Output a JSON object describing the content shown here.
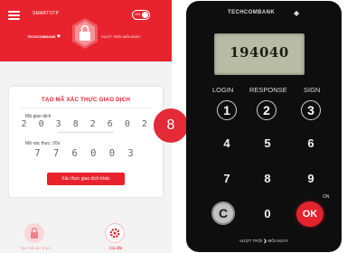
{
  "app": {
    "name": "SMARTOTP",
    "toggle_label": "ON",
    "brand_left": "TECHCOMBANK",
    "brand_right": "VƯỢT TRỘI  MỖI NGÀY",
    "accent_color": "#e8232e"
  },
  "card": {
    "title": "TẠO MÃ XÁC THỰC GIAO DỊCH",
    "transaction_code_label": "Mã giao dịch",
    "transaction_code": "2 0 3 8 2 6 0 2",
    "otp_label": "Mã xác thực: 26s",
    "otp_value": "7 7 6 0 0 3",
    "button_label": "Xác thực giao dịch khác"
  },
  "bottom_nav": [
    {
      "label": "Tạo mã xác thực",
      "icon": "lock-icon",
      "active": false
    },
    {
      "label": "Cài đặt",
      "icon": "gear-icon",
      "active": true
    }
  ],
  "step": {
    "number": "8"
  },
  "token": {
    "brand": "TECHCOMBANK",
    "display_value": "194040",
    "function_labels": [
      "LOGIN",
      "RESPONSE",
      "SIGN"
    ],
    "keys": [
      "1",
      "2",
      "3",
      "4",
      "5",
      "6",
      "7",
      "8",
      "9",
      "C",
      "0",
      "OK"
    ],
    "on_label": "ON",
    "slogan_left": "VƯỢT TRỘI",
    "slogan_right": "MỖI NGÀY"
  }
}
